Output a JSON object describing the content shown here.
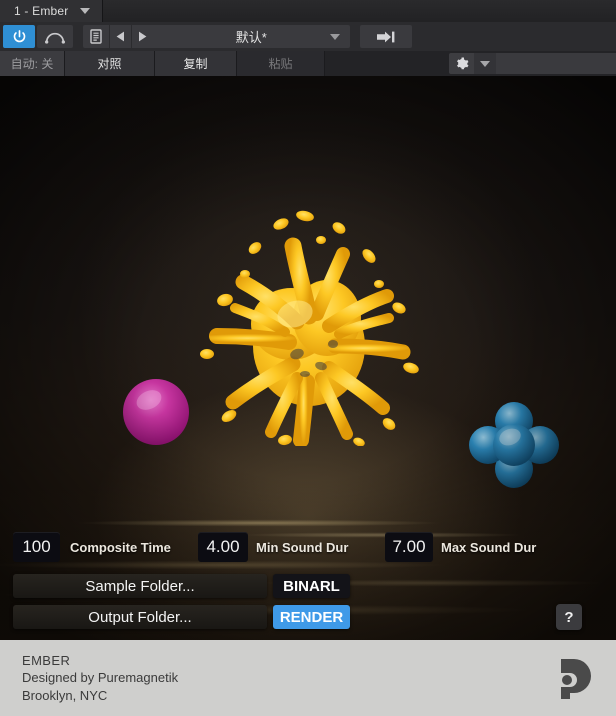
{
  "window": {
    "tab_title": "1 - Ember",
    "tab_caret_icon": "chevron-down-icon"
  },
  "header": {
    "power_icon": "power-icon",
    "curve_icon": "automation-curve-icon",
    "document_icon": "document-icon",
    "prev_icon": "prev-arrow-icon",
    "next_icon": "next-arrow-icon",
    "preset_name": "默认*",
    "preset_caret_icon": "chevron-down-icon",
    "skip_icon": "skip-to-end-icon",
    "gear_icon": "gear-icon",
    "gear_caret_icon": "chevron-down-icon",
    "buttons": {
      "automation": "自动: 关",
      "compare": "对照",
      "copy": "复制",
      "paste": "粘贴"
    }
  },
  "artwork": {
    "splatter_color": "#f5c21c",
    "sphere_color": "#c02a9a",
    "cross_color": "#2f8fc4",
    "background_color": "#1a1512"
  },
  "controls": {
    "composite_time": {
      "value": "100",
      "label": "Composite Time"
    },
    "min_sound_dur": {
      "value": "4.00",
      "label": "Min Sound Dur"
    },
    "max_sound_dur": {
      "value": "7.00",
      "label": "Max Sound Dur"
    },
    "sample_folder": "Sample Folder...",
    "output_folder": "Output Folder...",
    "binaural": "BINARL",
    "render": "RENDER",
    "help": "?",
    "accent_color": "#3f9ae8"
  },
  "footer": {
    "product": "EMBER",
    "designer": "Designed by Puremagnetik",
    "location": "Brooklyn, NYC",
    "logo_icon": "puremagnetik-logo-icon"
  }
}
